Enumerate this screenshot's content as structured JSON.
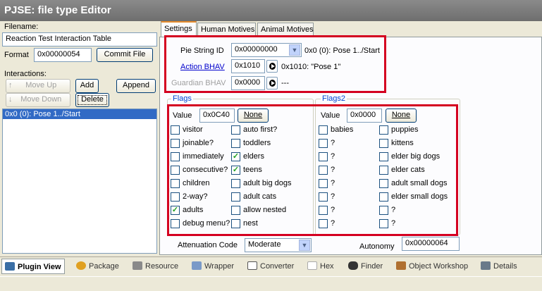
{
  "window": {
    "title": "PJSE: file type Editor"
  },
  "left": {
    "filename_label": "Filename:",
    "filename_value": "Reaction Test Interaction Table",
    "format_label": "Format",
    "format_value": "0x00000054",
    "commit_label": "Commit File",
    "interactions_label": "Interactions:",
    "move_up": "Move Up",
    "add": "Add",
    "append": "Append",
    "move_down": "Move Down",
    "delete": "Delete",
    "list": [
      "0x0 (0): Pose 1../Start"
    ]
  },
  "tabs": [
    "Settings",
    "Human Motives",
    "Animal Motives"
  ],
  "settings": {
    "pie_label": "Pie String ID",
    "pie_value": "0x00000000",
    "pie_desc": "0x0 (0): Pose 1../Start",
    "action_label": "Action BHAV",
    "action_value": "0x1010",
    "action_desc": "0x1010: \"Pose 1\"",
    "guardian_label": "Guardian BHAV",
    "guardian_value": "0x0000",
    "guardian_desc": "---"
  },
  "flags": {
    "title": "Flags",
    "value_label": "Value",
    "value": "0x0C40",
    "none_label": "None",
    "col1": [
      {
        "label": "visitor",
        "checked": false
      },
      {
        "label": "joinable?",
        "checked": false
      },
      {
        "label": "immediately",
        "checked": false
      },
      {
        "label": "consecutive?",
        "checked": false
      },
      {
        "label": "children",
        "checked": false
      },
      {
        "label": "2-way?",
        "checked": false
      },
      {
        "label": "adults",
        "checked": true
      },
      {
        "label": "debug menu?",
        "checked": false
      }
    ],
    "col2": [
      {
        "label": "auto first?",
        "checked": false
      },
      {
        "label": "toddlers",
        "checked": false
      },
      {
        "label": "elders",
        "checked": true
      },
      {
        "label": "teens",
        "checked": true
      },
      {
        "label": "adult big dogs",
        "checked": false
      },
      {
        "label": "adult cats",
        "checked": false
      },
      {
        "label": "allow nested",
        "checked": false
      },
      {
        "label": "nest",
        "checked": false
      }
    ]
  },
  "flags2": {
    "title": "Flags2",
    "value_label": "Value",
    "value": "0x0000",
    "none_label": "None",
    "col1": [
      {
        "label": "babies",
        "checked": false
      },
      {
        "label": "?",
        "checked": false
      },
      {
        "label": "?",
        "checked": false
      },
      {
        "label": "?",
        "checked": false
      },
      {
        "label": "?",
        "checked": false
      },
      {
        "label": "?",
        "checked": false
      },
      {
        "label": "?",
        "checked": false
      },
      {
        "label": "?",
        "checked": false
      }
    ],
    "col2": [
      {
        "label": "puppies",
        "checked": false
      },
      {
        "label": "kittens",
        "checked": false
      },
      {
        "label": "elder big dogs",
        "checked": false
      },
      {
        "label": "elder cats",
        "checked": false
      },
      {
        "label": "adult small dogs",
        "checked": false
      },
      {
        "label": "elder small dogs",
        "checked": false
      },
      {
        "label": "?",
        "checked": false
      },
      {
        "label": "?",
        "checked": false
      }
    ]
  },
  "bottom": {
    "attenuation_label": "Attenuation Code",
    "attenuation_value": "Moderate",
    "autonomy_label": "Autonomy",
    "autonomy_value": "0x00000064"
  },
  "bottom_tabs": [
    {
      "label": "Plugin View",
      "icon": "plugin-view-icon",
      "color": "#3a6ea5"
    },
    {
      "label": "Package",
      "icon": "package-icon",
      "color": "#e0a020"
    },
    {
      "label": "Resource",
      "icon": "resource-icon",
      "color": "#8a8a8a"
    },
    {
      "label": "Wrapper",
      "icon": "wrapper-icon",
      "color": "#7a9ac8"
    },
    {
      "label": "Converter",
      "icon": "converter-icon",
      "color": "#555555"
    },
    {
      "label": "Hex",
      "icon": "hex-icon",
      "color": "#aaaaaa"
    },
    {
      "label": "Finder",
      "icon": "finder-icon",
      "color": "#333333"
    },
    {
      "label": "Object Workshop",
      "icon": "object-workshop-icon",
      "color": "#b07030"
    },
    {
      "label": "Details",
      "icon": "details-icon",
      "color": "#6a7a8a"
    }
  ]
}
